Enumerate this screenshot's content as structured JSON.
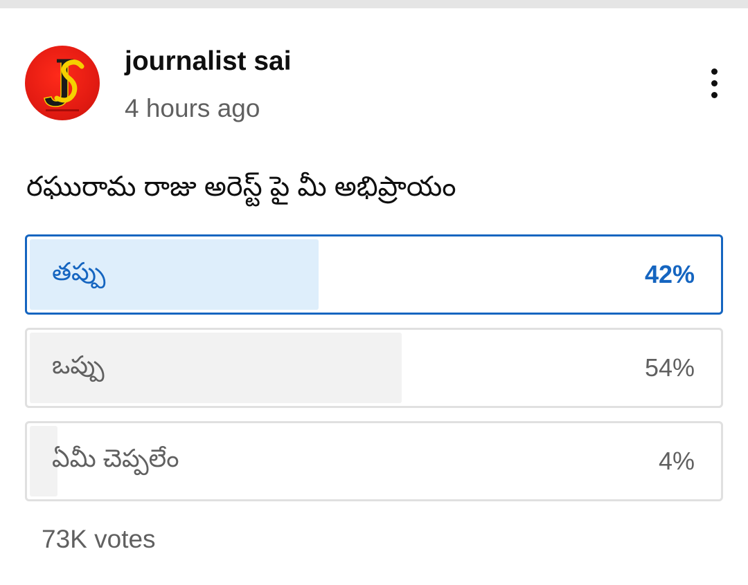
{
  "post": {
    "channel_name": "journalist sai",
    "time_ago": "4 hours ago",
    "avatar_logo_text": "JS",
    "more_icon": "more-vertical-icon"
  },
  "poll": {
    "question": "రఘురామ రాజు అరెస్ట్ పై మీ అభిప్రాయం",
    "options": [
      {
        "label": "తప్పు",
        "percent_label": "42%",
        "percent": 42,
        "selected": true
      },
      {
        "label": "ఒప్పు",
        "percent_label": "54%",
        "percent": 54,
        "selected": false
      },
      {
        "label": "ఏమీ చెప్పలేం",
        "percent_label": "4%",
        "percent": 4,
        "selected": false
      }
    ],
    "votes": "73K votes"
  },
  "colors": {
    "selected_accent": "#1565c0",
    "selected_fill": "#deeefb",
    "unselected_fill": "#f2f2f2",
    "avatar_bg": "#e31b12",
    "avatar_letters": "#f5d000"
  }
}
